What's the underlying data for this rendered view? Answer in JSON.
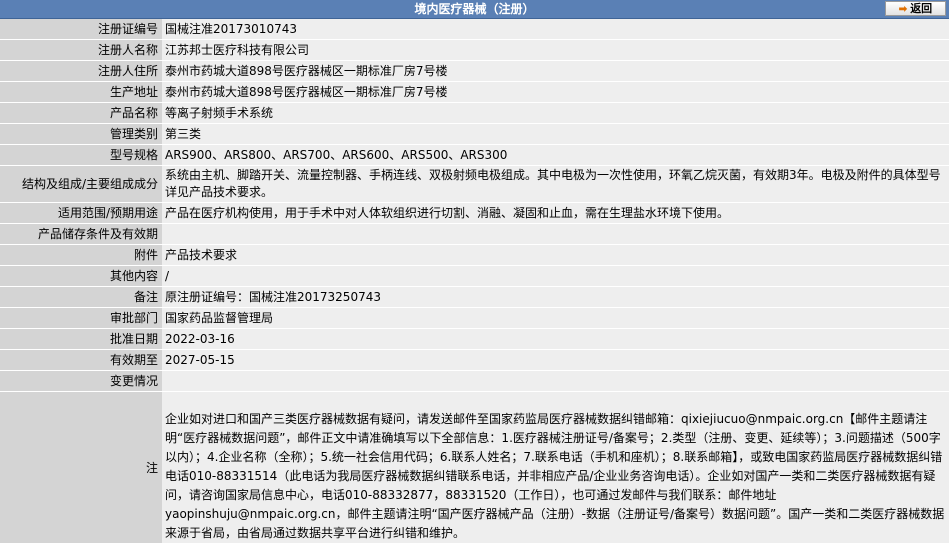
{
  "header": {
    "title": "境内医疗器械（注册）",
    "back_label": "返回"
  },
  "rows": [
    {
      "label": "注册证编号",
      "value": "国械注准20173010743"
    },
    {
      "label": "注册人名称",
      "value": "江苏邦士医疗科技有限公司"
    },
    {
      "label": "注册人住所",
      "value": "泰州市药城大道898号医疗器械区一期标准厂房7号楼"
    },
    {
      "label": "生产地址",
      "value": "泰州市药城大道898号医疗器械区一期标准厂房7号楼"
    },
    {
      "label": "产品名称",
      "value": "等离子射频手术系统"
    },
    {
      "label": "管理类别",
      "value": "第三类"
    },
    {
      "label": "型号规格",
      "value": "ARS900、ARS800、ARS700、ARS600、ARS500、ARS300"
    },
    {
      "label": "结构及组成/主要组成成分",
      "value": "系统由主机、脚踏开关、流量控制器、手柄连线、双极射频电极组成。其中电极为一次性使用，环氧乙烷灭菌，有效期3年。电极及附件的具体型号详见产品技术要求。"
    },
    {
      "label": "适用范围/预期用途",
      "value": "产品在医疗机构使用，用于手术中对人体软组织进行切割、消融、凝固和止血，需在生理盐水环境下使用。"
    },
    {
      "label": "产品储存条件及有效期",
      "value": ""
    },
    {
      "label": "附件",
      "value": "产品技术要求"
    },
    {
      "label": "其他内容",
      "value": "/"
    },
    {
      "label": "备注",
      "value": "原注册证编号：国械注准20173250743"
    },
    {
      "label": "审批部门",
      "value": "国家药品监督管理局"
    },
    {
      "label": "批准日期",
      "value": "2022-03-16"
    },
    {
      "label": "有效期至",
      "value": "2027-05-15"
    },
    {
      "label": "变更情况",
      "value": ""
    }
  ],
  "note": {
    "label": "注",
    "text": "企业如对进口和国产三类医疗器械数据有疑问，请发送邮件至国家药监局医疗器械数据纠错邮箱：qixiejiucuo@nmpaic.org.cn【邮件主题请注明“医疗器械数据问题”，邮件正文中请准确填写以下全部信息：1.医疗器械注册证号/备案号；2.类型（注册、变更、延续等）；3.问题描述（500字以内）；4.企业名称（全称）；5.统一社会信用代码；6.联系人姓名；7.联系电话（手机和座机）；8.联系邮箱】，或致电国家药监局医疗器械数据纠错电话010-88331514（此电话为我局医疗器械数据纠错联系电话，并非相应产品/企业业务咨询电话）。企业如对国产一类和二类医疗器械数据有疑问，请咨询国家局信息中心，电话010-88332877，88331520（工作日），也可通过发邮件与我们联系：邮件地址yaopinshuju@nmpaic.org.cn，邮件主题请注明“国产医疗器械产品（注册）-数据（注册证号/备案号）数据问题”。国产一类和二类医疗器械数据来源于省局，由省局通过数据共享平台进行纠错和维护。"
  }
}
